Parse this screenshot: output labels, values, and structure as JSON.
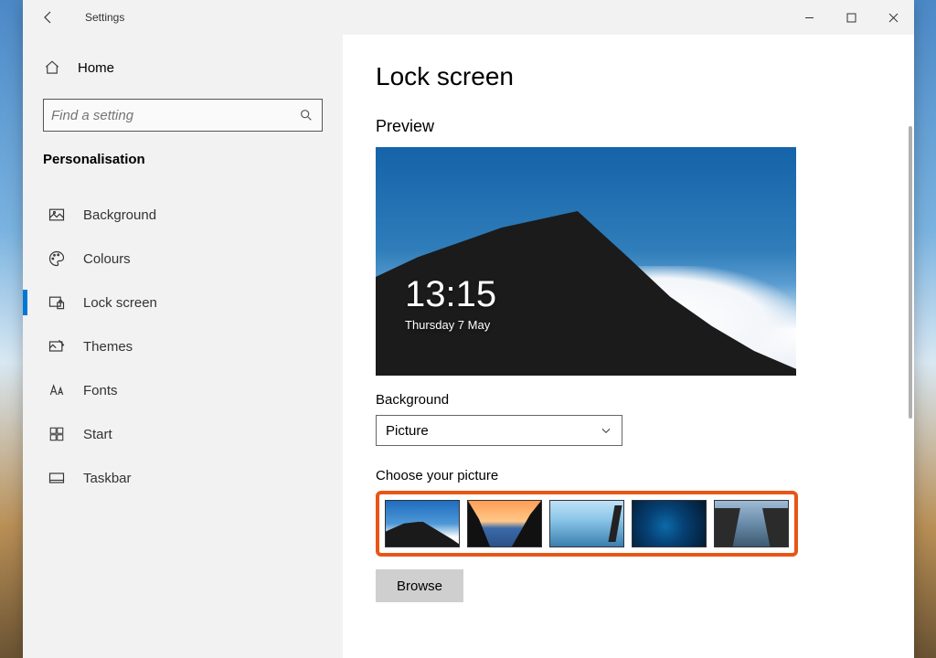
{
  "window": {
    "title": "Settings"
  },
  "sidebar": {
    "home_label": "Home",
    "search_placeholder": "Find a setting",
    "section_label": "Personalisation",
    "items": [
      {
        "label": "Background"
      },
      {
        "label": "Colours"
      },
      {
        "label": "Lock screen"
      },
      {
        "label": "Themes"
      },
      {
        "label": "Fonts"
      },
      {
        "label": "Start"
      },
      {
        "label": "Taskbar"
      }
    ]
  },
  "content": {
    "page_title": "Lock screen",
    "preview_heading": "Preview",
    "preview_time": "13:15",
    "preview_date": "Thursday 7 May",
    "background_label": "Background",
    "background_value": "Picture",
    "choose_picture_label": "Choose your picture",
    "browse_label": "Browse"
  }
}
